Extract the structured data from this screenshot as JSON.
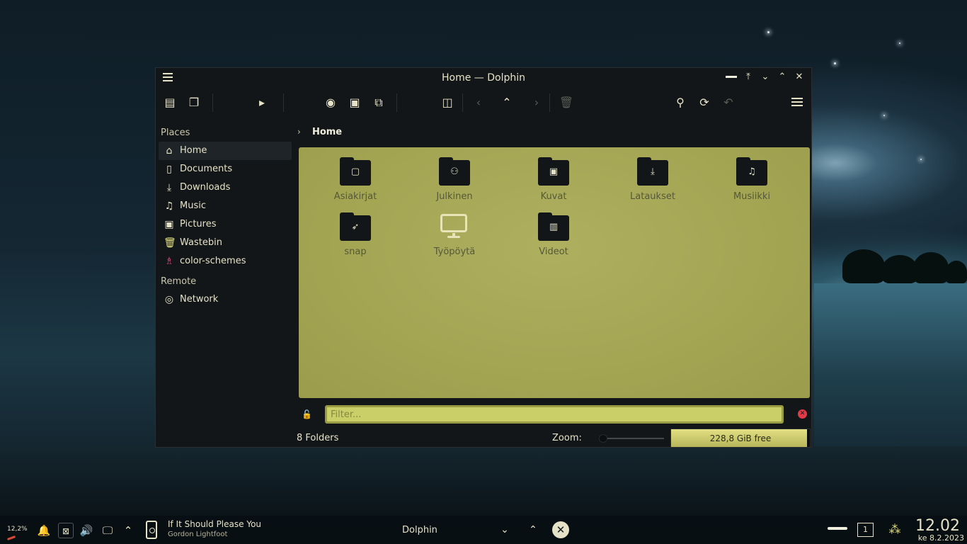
{
  "window": {
    "title": "Home — Dolphin",
    "controls": [
      "minimize-line",
      "keep-above",
      "keep-below",
      "maximize",
      "close"
    ]
  },
  "toolbar": {
    "icons": [
      "panels",
      "new-tab",
      "terminal",
      "preview",
      "image",
      "new-window",
      "split-view",
      "back",
      "up",
      "forward",
      "delete",
      "search",
      "reload",
      "undo",
      "hamburger-menu"
    ]
  },
  "sidebar": {
    "places_title": "Places",
    "places": [
      {
        "label": "Home",
        "icon": "home-icon",
        "active": true
      },
      {
        "label": "Documents",
        "icon": "documents-icon"
      },
      {
        "label": "Downloads",
        "icon": "downloads-icon"
      },
      {
        "label": "Music",
        "icon": "music-icon"
      },
      {
        "label": "Pictures",
        "icon": "pictures-icon"
      },
      {
        "label": "Wastebin",
        "icon": "wastebin-icon"
      },
      {
        "label": "color-schemes",
        "icon": "color-schemes-icon"
      }
    ],
    "remote_title": "Remote",
    "remote": [
      {
        "label": "Network",
        "icon": "network-icon"
      }
    ]
  },
  "breadcrumb": {
    "current": "Home"
  },
  "folders": [
    {
      "label": "Asiakirjat",
      "icon": "document-folder-icon"
    },
    {
      "label": "Julkinen",
      "icon": "public-folder-icon"
    },
    {
      "label": "Kuvat",
      "icon": "pictures-folder-icon"
    },
    {
      "label": "Lataukset",
      "icon": "downloads-folder-icon"
    },
    {
      "label": "Musiikki",
      "icon": "music-folder-icon"
    },
    {
      "label": "snap",
      "icon": "snap-folder-icon"
    },
    {
      "label": "Työpöytä",
      "icon": "desktop-monitor-icon"
    },
    {
      "label": "Videot",
      "icon": "videos-folder-icon"
    }
  ],
  "filter": {
    "placeholder": "Filter..."
  },
  "status": {
    "count": "8 Folders",
    "zoom_label": "Zoom:",
    "zoom_level": 0.0,
    "free_space": "228,8 GiB free",
    "used_fraction": 0.98
  },
  "taskbar": {
    "cpu": "12,2%",
    "song": "If It Should Please You",
    "artist": "Gordon Lightfoot",
    "task": "Dolphin",
    "pager": "1",
    "time": "12.02",
    "date": "ke 8.2.2023"
  },
  "colors": {
    "view_bg": "#a3a553",
    "window_bg": "#131618",
    "accent": "#e2e083",
    "close_red": "#e23a48"
  }
}
